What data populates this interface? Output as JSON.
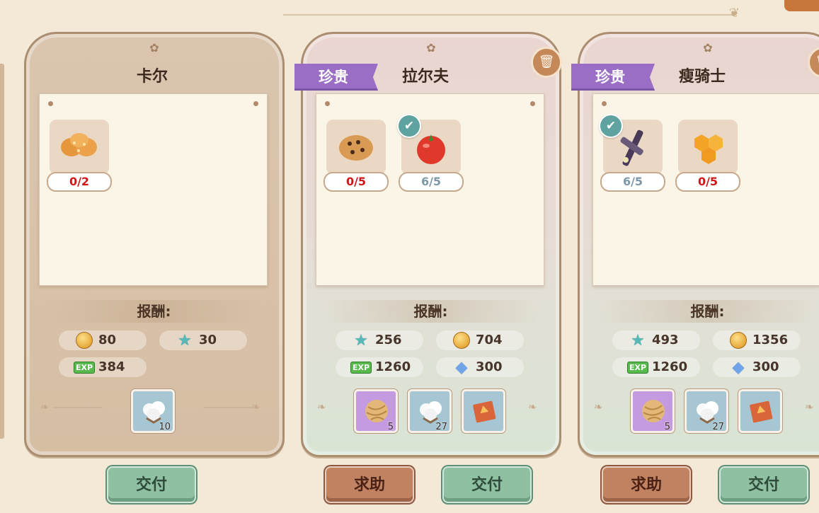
{
  "cards": [
    {
      "name": "卡尔",
      "rare": false,
      "items": [
        {
          "icon": "bread-icon",
          "count": "0/2",
          "done": false
        }
      ],
      "reward_title": "报酬:",
      "rewards": [
        {
          "icon": "gold-coin-icon",
          "value": "80"
        },
        {
          "icon": "star-icon",
          "value": "30"
        },
        {
          "icon": "exp-icon",
          "value": "384"
        }
      ],
      "bonus_items": [
        {
          "icon": "cotton-icon",
          "qty": "10",
          "tone": "blue"
        }
      ],
      "buttons": [
        {
          "label": "交付",
          "kind": "deliver"
        }
      ]
    },
    {
      "name": "拉尔夫",
      "rare": true,
      "rare_label": "珍贵",
      "items": [
        {
          "icon": "cookie-icon",
          "count": "0/5",
          "done": false
        },
        {
          "icon": "tomato-icon",
          "count": "6/5",
          "done": true
        }
      ],
      "reward_title": "报酬:",
      "rewards": [
        {
          "icon": "star-icon",
          "value": "256"
        },
        {
          "icon": "gold-coin-icon",
          "value": "704"
        },
        {
          "icon": "exp-icon",
          "value": "1260"
        },
        {
          "icon": "crystal-icon",
          "value": "300"
        }
      ],
      "bonus_items": [
        {
          "icon": "yarn-icon",
          "qty": "5",
          "tone": "purple"
        },
        {
          "icon": "cotton-icon",
          "qty": "27",
          "tone": "blue"
        },
        {
          "icon": "book-icon",
          "qty": "",
          "tone": "blue"
        }
      ],
      "buttons": [
        {
          "label": "求助",
          "kind": "help"
        },
        {
          "label": "交付",
          "kind": "deliver"
        }
      ]
    },
    {
      "name": "瘦骑士",
      "rare": true,
      "rare_label": "珍贵",
      "items": [
        {
          "icon": "sugarcane-icon",
          "count": "6/5",
          "done": true
        },
        {
          "icon": "honeycomb-icon",
          "count": "0/5",
          "done": false
        }
      ],
      "reward_title": "报酬:",
      "rewards": [
        {
          "icon": "star-icon",
          "value": "493"
        },
        {
          "icon": "gold-coin-icon",
          "value": "1356"
        },
        {
          "icon": "exp-icon",
          "value": "1260"
        },
        {
          "icon": "crystal-icon",
          "value": "300"
        }
      ],
      "bonus_items": [
        {
          "icon": "yarn-icon",
          "qty": "5",
          "tone": "purple"
        },
        {
          "icon": "cotton-icon",
          "qty": "27",
          "tone": "blue"
        },
        {
          "icon": "book-icon",
          "qty": "",
          "tone": "blue"
        }
      ],
      "buttons": [
        {
          "label": "求助",
          "kind": "help"
        },
        {
          "label": "交付",
          "kind": "deliver"
        }
      ]
    }
  ],
  "colors": {
    "rare_tag": "#9b6ec6",
    "deliver_button": "#8fc0a1",
    "help_button": "#c18261",
    "count_incomplete": "#d1161a",
    "count_complete": "#7d98a7"
  }
}
